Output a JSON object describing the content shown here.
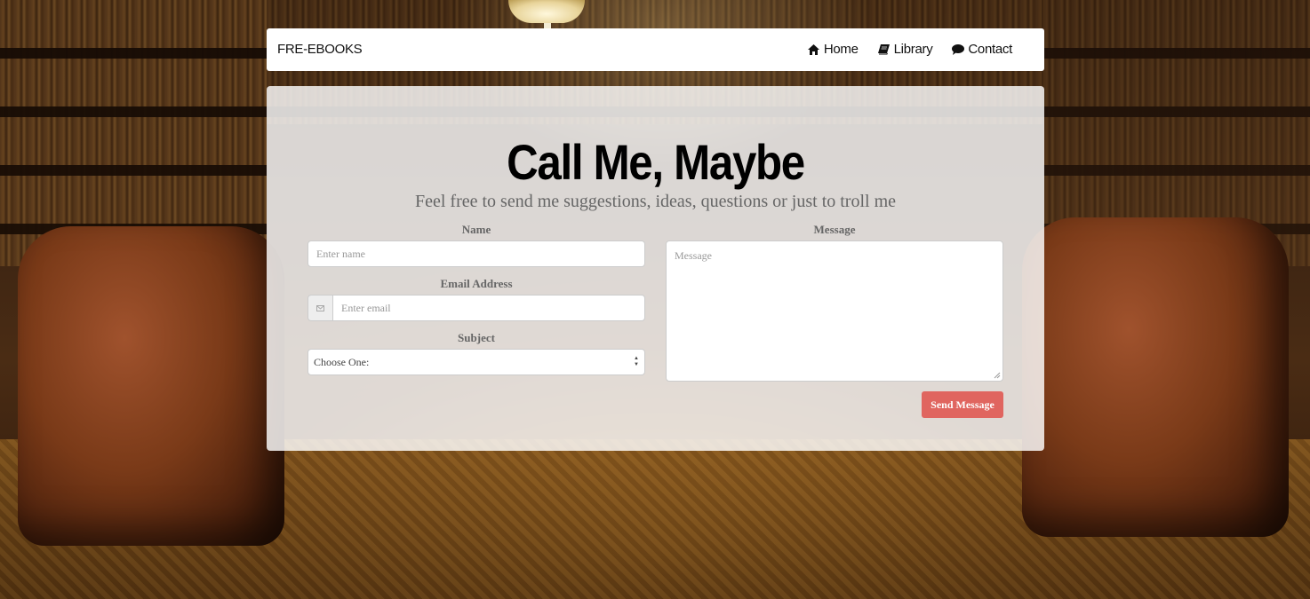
{
  "navbar": {
    "brand": "FRE-EBOOKS",
    "links": [
      {
        "label": "Home",
        "icon": "home-icon"
      },
      {
        "label": "Library",
        "icon": "book-icon"
      },
      {
        "label": "Contact",
        "icon": "comment-icon"
      }
    ]
  },
  "contact": {
    "title": "Call Me, Maybe",
    "subtitle": "Feel free to send me suggestions, ideas, questions or just to troll me",
    "name": {
      "label": "Name",
      "placeholder": "Enter name"
    },
    "email": {
      "label": "Email Address",
      "placeholder": "Enter email",
      "icon": "envelope-icon"
    },
    "subject": {
      "label": "Subject",
      "selected": "Choose One:"
    },
    "message": {
      "label": "Message",
      "placeholder": "Message"
    },
    "send_label": "Send Message"
  },
  "colors": {
    "accent": "#e0655f",
    "panel": "rgba(255,255,255,0.82)"
  }
}
